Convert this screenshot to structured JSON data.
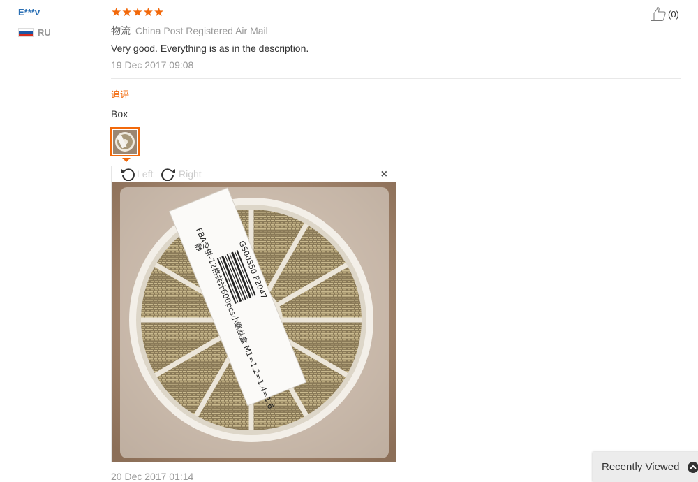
{
  "buyer": {
    "name": "E***v",
    "country": "RU"
  },
  "review": {
    "rating": 5,
    "stars": [
      "★",
      "★",
      "★",
      "★",
      "★"
    ],
    "logistics_label": "物流",
    "logistics_value": "China Post Registered Air Mail",
    "text": "Very good. Everything is as in the description.",
    "date": "19 Dec 2017 09:08",
    "likes": "(0)"
  },
  "additional": {
    "label": "追评",
    "text": "Box",
    "date": "20 Dec 2017 01:14"
  },
  "image_viewer": {
    "rotate_left": "Left",
    "rotate_right": "Right",
    "close": "×",
    "photo_label_lines": [
      "静",
      "FBA专供-12格共计600pcs小螺丝盒 M1=1.2=1.4=1.6",
      "GS00350    P2047"
    ]
  },
  "recently_viewed": {
    "label": "Recently Viewed"
  },
  "colors": {
    "accent": "#f2690b",
    "link": "#2a6fb4",
    "muted": "#999999"
  },
  "icons": [
    "russia-flag-icon",
    "star-icon",
    "thumbs-up-icon",
    "rotate-left-icon",
    "rotate-right-icon",
    "close-icon",
    "chevron-up-icon"
  ]
}
